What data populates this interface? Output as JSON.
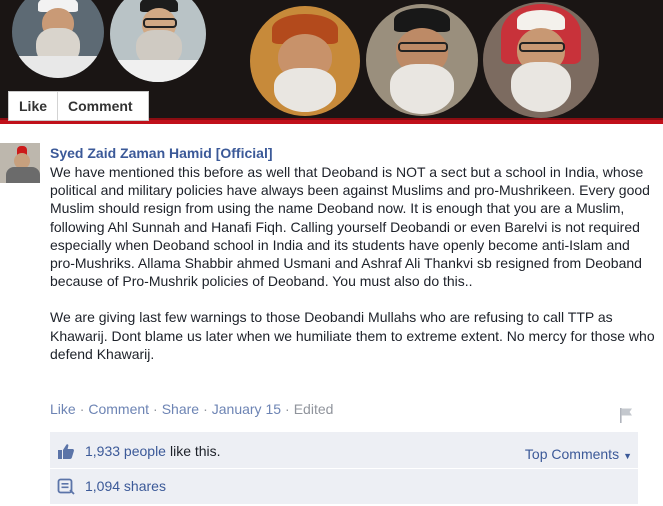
{
  "cover": {
    "like_label": "Like",
    "comment_label": "Comment"
  },
  "post": {
    "author": "Syed Zaid Zaman Hamid [Official]",
    "paragraphs": [
      "We have mentioned this before as well that Deoband is NOT a sect but a school in India, whose political and military policies have always been against Muslims and pro-Mushrikeen. Every good Muslim should resign from using the name Deoband now. It is enough that you are a Muslim, following Ahl Sunnah and Hanafi Fiqh. Calling yourself Deobandi or even Barelvi is not required especially when Deoband school in India and its students have openly become anti-Islam and pro-Mushriks. Allama Shabbir ahmed Usmani and Ashraf Ali Thankvi sb resigned from Deoband because of Pro-Mushrik policies of Deoband. You must also do this..",
      "We are giving last few warnings to those Deobandi Mullahs who are refusing to call TTP as Khawarij. Dont blame us later when we humiliate them to extreme extent. No mercy for those who defend Khawarij."
    ],
    "actions": {
      "like": "Like",
      "comment": "Comment",
      "share": "Share",
      "date": "January 15",
      "edited": "Edited",
      "separator": "·"
    }
  },
  "footer": {
    "likes_count": "1,933 people",
    "likes_suffix": "like this.",
    "top_comments": "Top Comments",
    "shares": "1,094 shares"
  },
  "icons": {
    "thumb": "thumbs-up-icon",
    "share": "share-icon",
    "flag": "flag-icon",
    "caret": "caret-down-icon"
  },
  "colors": {
    "link": "#3b5998",
    "muted": "#90949c",
    "footer_bg": "#edeff4",
    "cover_border": "#c0101a"
  }
}
